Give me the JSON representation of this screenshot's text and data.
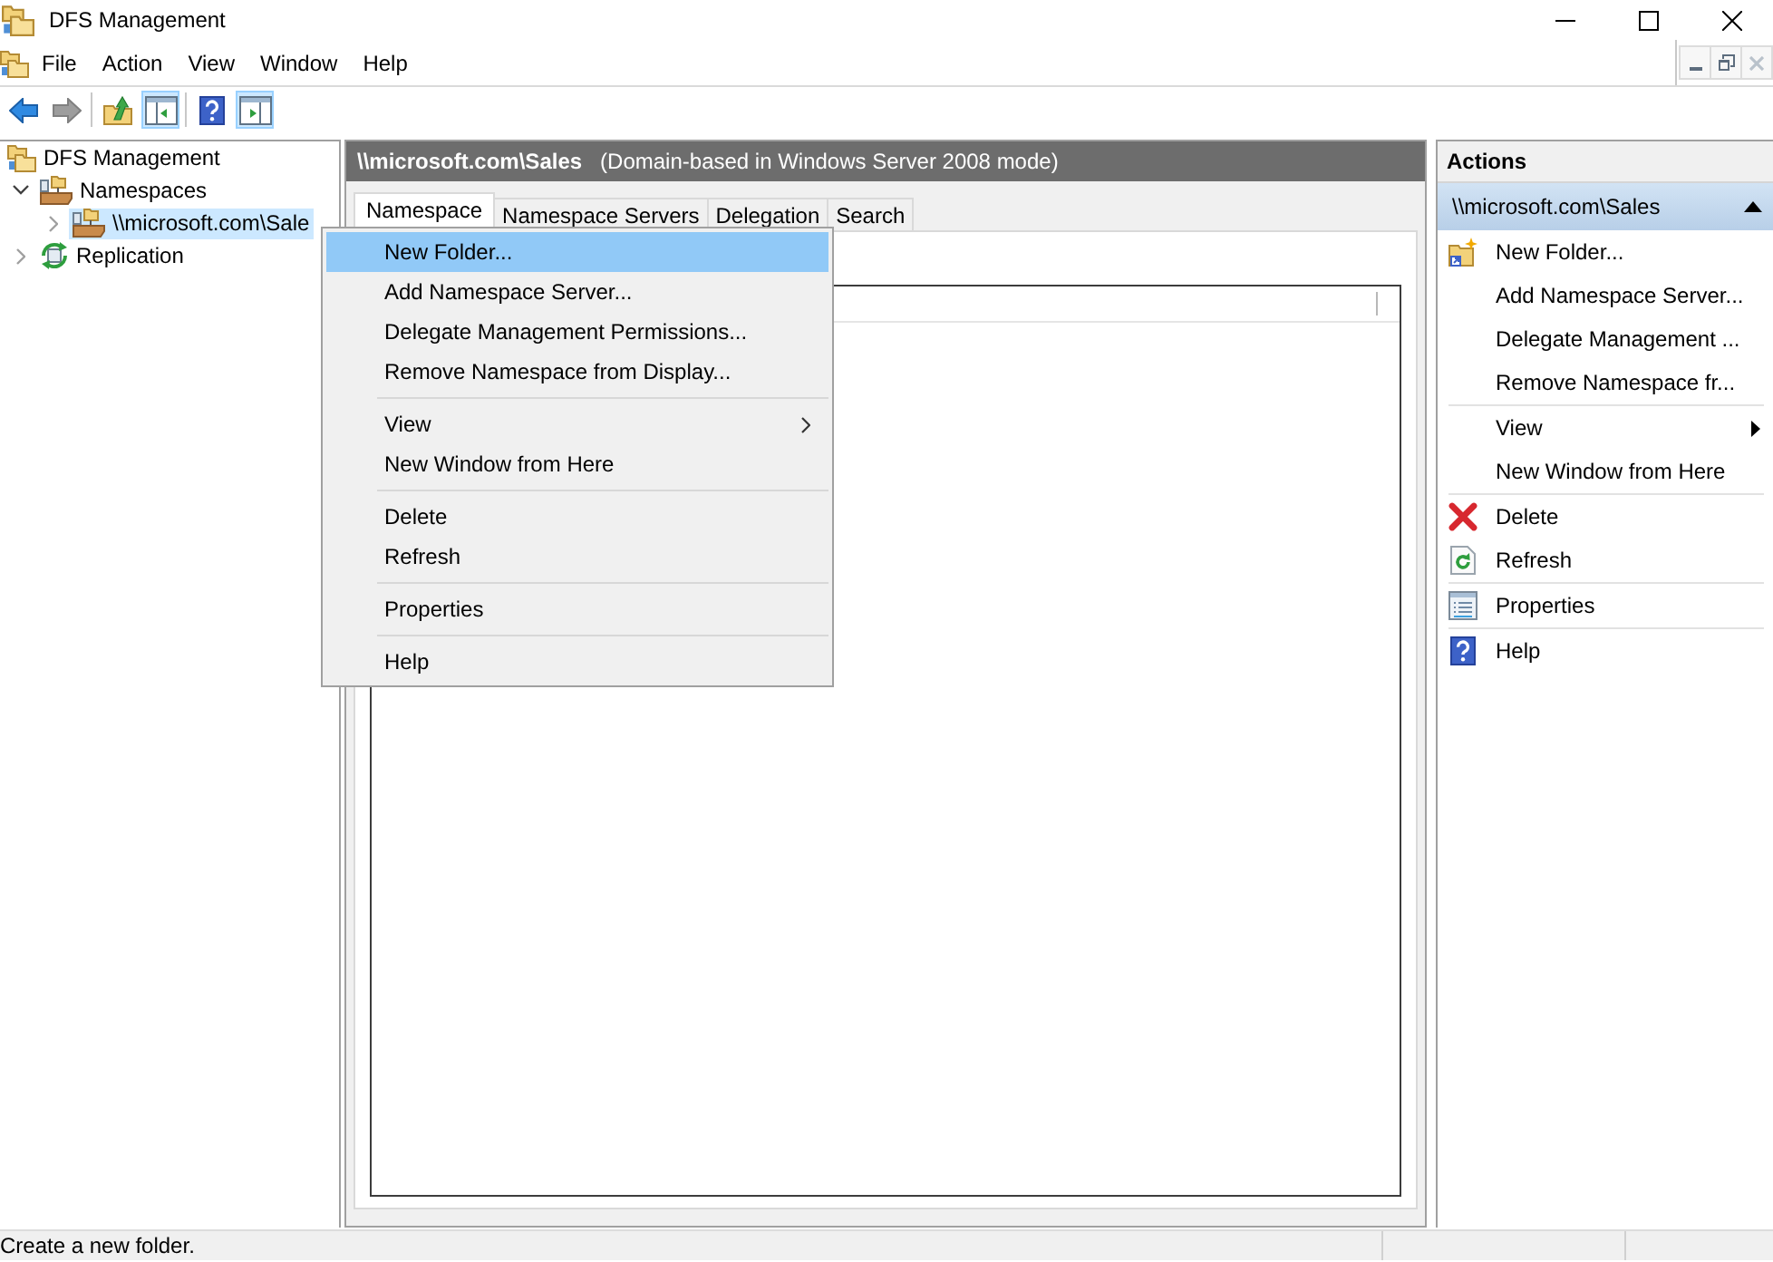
{
  "window": {
    "title": "DFS Management"
  },
  "menu_bar": {
    "items": [
      "File",
      "Action",
      "View",
      "Window",
      "Help"
    ],
    "mdi_controls": [
      {
        "kind": "minimize",
        "disabled": false
      },
      {
        "kind": "restore",
        "disabled": false
      },
      {
        "kind": "close",
        "disabled": true
      }
    ]
  },
  "toolbar": [
    {
      "kind": "back",
      "disabled": false,
      "pressed": false
    },
    {
      "kind": "forward",
      "disabled": true,
      "pressed": false
    },
    {
      "kind": "separator"
    },
    {
      "kind": "up",
      "disabled": false,
      "pressed": false
    },
    {
      "kind": "console_tree",
      "disabled": false,
      "pressed": true
    },
    {
      "kind": "separator"
    },
    {
      "kind": "help",
      "disabled": false,
      "pressed": false
    },
    {
      "kind": "action_pane",
      "disabled": false,
      "pressed": true
    }
  ],
  "tree": [
    {
      "label": "DFS Management",
      "kind": "root",
      "selected": false,
      "children": [
        {
          "label": "Namespaces",
          "kind": "namespaces",
          "expanded": true,
          "selected": false,
          "children": [
            {
              "label": "\\\\microsoft.com\\Sale",
              "kind": "namespace",
              "expanded": false,
              "selected": true
            }
          ]
        },
        {
          "label": "Replication",
          "kind": "replication",
          "expanded": false,
          "selected": false
        }
      ]
    }
  ],
  "details": {
    "header": {
      "title": "\\\\microsoft.com\\Sales",
      "subtitle": "(Domain-based in Windows Server 2008 mode)"
    },
    "tabs": [
      {
        "label": "Namespace",
        "selected": true
      },
      {
        "label": "Namespace Servers",
        "selected": false
      },
      {
        "label": "Delegation",
        "selected": false
      },
      {
        "label": "Search",
        "selected": false
      }
    ]
  },
  "context_menu": {
    "groups": [
      {
        "items": [
          {
            "label": "New Folder...",
            "kind": "command",
            "selected": true
          },
          {
            "label": "Add Namespace Server...",
            "kind": "command",
            "selected": false
          },
          {
            "label": "Delegate Management Permissions...",
            "kind": "command",
            "selected": false
          },
          {
            "label": "Remove Namespace from Display...",
            "kind": "command",
            "selected": false
          }
        ]
      },
      {
        "items": [
          {
            "label": "View",
            "kind": "submenu",
            "selected": false
          },
          {
            "label": "New Window from Here",
            "kind": "command",
            "selected": false
          }
        ]
      },
      {
        "items": [
          {
            "label": "Delete",
            "kind": "command",
            "selected": false
          },
          {
            "label": "Refresh",
            "kind": "command",
            "selected": false
          }
        ]
      },
      {
        "items": [
          {
            "label": "Properties",
            "kind": "command",
            "selected": false
          }
        ]
      },
      {
        "items": [
          {
            "label": "Help",
            "kind": "command",
            "selected": false
          }
        ]
      }
    ]
  },
  "actions": {
    "title": "Actions",
    "section": {
      "title": "\\\\microsoft.com\\Sales",
      "expanded": true
    },
    "groups": [
      {
        "items": [
          {
            "label": "New Folder...",
            "kind": "new_folder"
          },
          {
            "label": "Add Namespace Server...",
            "kind": "command"
          },
          {
            "label": "Delegate Management ...",
            "kind": "command"
          },
          {
            "label": "Remove Namespace fr...",
            "kind": "command"
          }
        ]
      },
      {
        "items": [
          {
            "label": "View",
            "kind": "submenu"
          },
          {
            "label": "New Window from Here",
            "kind": "command"
          }
        ]
      },
      {
        "items": [
          {
            "label": "Delete",
            "kind": "delete"
          },
          {
            "label": "Refresh",
            "kind": "refresh"
          }
        ]
      },
      {
        "items": [
          {
            "label": "Properties",
            "kind": "properties"
          }
        ]
      },
      {
        "items": [
          {
            "label": "Help",
            "kind": "help"
          }
        ]
      }
    ]
  },
  "status_bar": {
    "text": "Create a new folder."
  }
}
